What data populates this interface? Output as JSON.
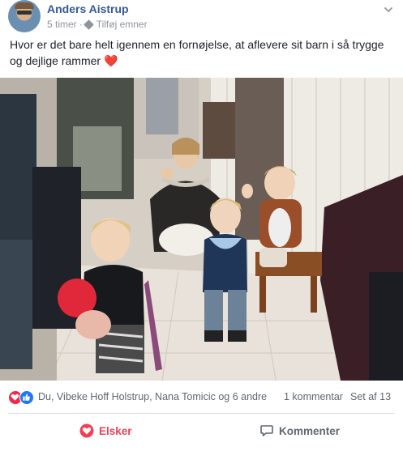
{
  "post": {
    "author": "Anders Aistrup",
    "time": "5 timer",
    "separator": "·",
    "tag_label": "Tilføj emner",
    "text": "Hvor er det bare helt igennem en fornøjelse, at aflevere sit barn i så trygge og dejlige rammer",
    "text_emoji": "❤️"
  },
  "reactions": {
    "icons": [
      "love-icon",
      "like-icon"
    ],
    "names": "Du, Vibeke Hoff Holstrup, Nana Tomicic og 6 andre",
    "comments": "1 kommentar",
    "seen": "Set af 13"
  },
  "actions": {
    "love_label": "Elsker",
    "comment_label": "Kommenter"
  },
  "colors": {
    "link": "#365899",
    "love": "#f33e58",
    "like": "#2078f4",
    "muted": "#606770"
  }
}
